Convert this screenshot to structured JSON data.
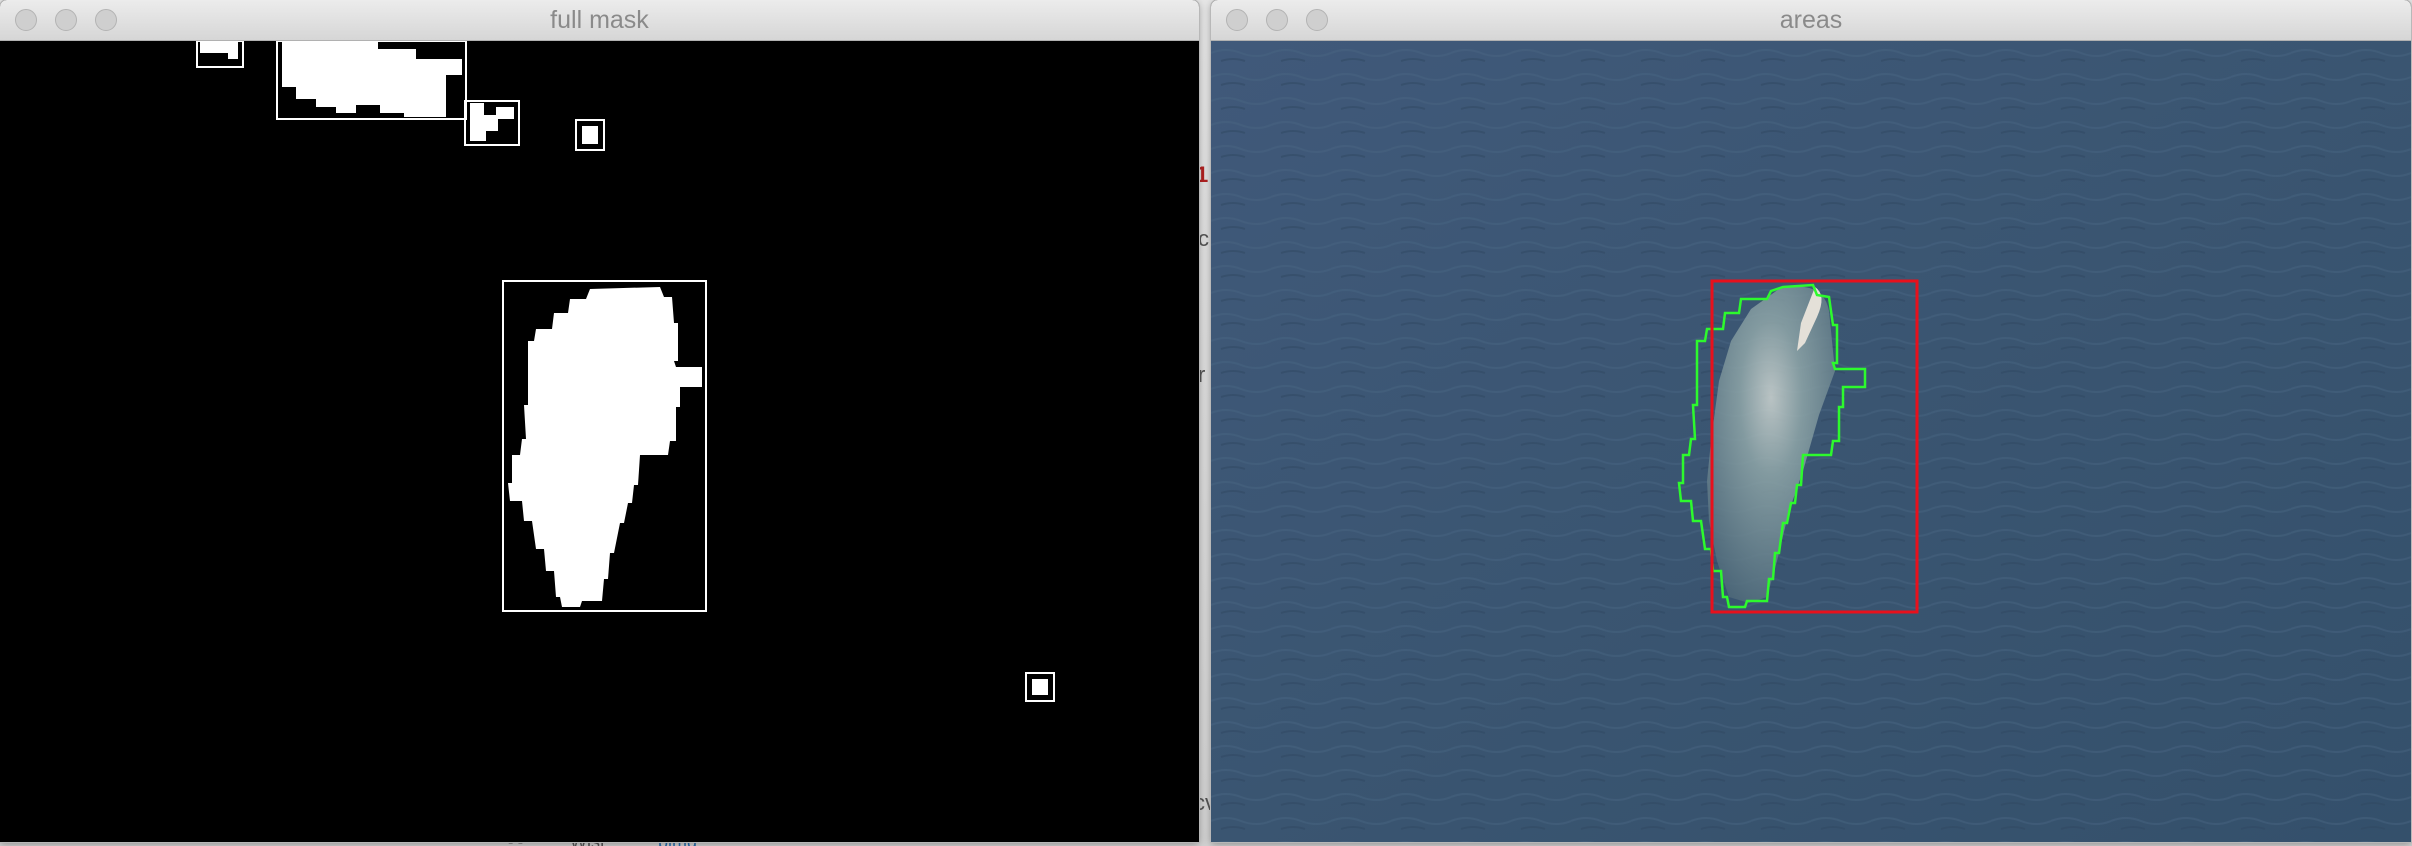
{
  "windows": {
    "left": {
      "title": "full mask"
    },
    "right": {
      "title": "areas"
    }
  },
  "background_peek": {
    "red_char": "1",
    "chars": [
      "c",
      "r",
      "cv",
      "- -",
      "Wjst",
      "blmg"
    ]
  },
  "colors": {
    "mask_bg": "#000000",
    "mask_fg": "#ffffff",
    "ocean": "#3b5670",
    "bbox": "#e8101c",
    "contour": "#2dfa2d"
  },
  "icons": [
    "close-icon",
    "minimize-icon",
    "zoom-icon"
  ]
}
